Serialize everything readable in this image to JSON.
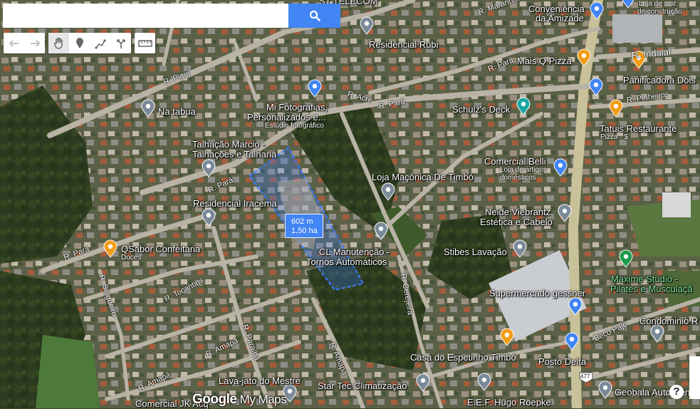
{
  "search": {
    "placeholder": "",
    "value": ""
  },
  "toolbar": {
    "undo": "undo",
    "redo": "redo",
    "pan": "pan",
    "marker": "marker",
    "line": "line",
    "directions": "directions",
    "measure": "measure"
  },
  "measurement": {
    "distance": "602 m",
    "area": "1,50 ha"
  },
  "pois": [
    {
      "label": "Residencial Rubi",
      "sub": ""
    },
    {
      "label": "Conveniência",
      "sub": ""
    },
    {
      "label": "da Amizade",
      "sub": ""
    },
    {
      "label": "Mais Q Pizza",
      "sub": ""
    },
    {
      "label": "Panificadora Dois",
      "sub": ""
    },
    {
      "label": "Na tabua",
      "sub": ""
    },
    {
      "label": "Mi Fotografias,",
      "sub": ""
    },
    {
      "label": "Personalizados e...",
      "sub": "Estúdio fotográfico"
    },
    {
      "label": "Schulz's Deck",
      "sub": ""
    },
    {
      "label": "Tatuis Restaurante",
      "sub": "Pizza · $"
    },
    {
      "label": "Talhação Marcio -",
      "sub": ""
    },
    {
      "label": "Talhações e Talharia",
      "sub": ""
    },
    {
      "label": "Comercial Belli",
      "sub": "Loja de artigos domésticos"
    },
    {
      "label": "Loja Maçônica De Timbó",
      "sub": ""
    },
    {
      "label": "Residencial Iracema",
      "sub": ""
    },
    {
      "label": "Neide Viebrantz",
      "sub": ""
    },
    {
      "label": "Estética e Cabelo",
      "sub": ""
    },
    {
      "label": "QSabor Confeitaria",
      "sub": "Doces"
    },
    {
      "label": "CL Manutenção -",
      "sub": ""
    },
    {
      "label": "Tornos Automáticos",
      "sub": ""
    },
    {
      "label": "Stibes Lavação",
      "sub": ""
    },
    {
      "label": "Maxime Studio -",
      "sub": ""
    },
    {
      "label": "Pilates e Musculaçã",
      "sub": ""
    },
    {
      "label": "Supermercado gessner",
      "sub": ""
    },
    {
      "label": "Condominio R",
      "sub": ""
    },
    {
      "label": "Casa do Espetinho Timbó",
      "sub": ""
    },
    {
      "label": "Posto Delta",
      "sub": ""
    },
    {
      "label": "Lava-jato do Mestre",
      "sub": ""
    },
    {
      "label": "Star Tec Climatização",
      "sub": ""
    },
    {
      "label": "Geobala Auto Cent",
      "sub": ""
    },
    {
      "label": "E.E.F. Hugo Roepke",
      "sub": ""
    },
    {
      "label": "Comercial JK Acq",
      "sub": ""
    },
    {
      "label": "ST TELECOM",
      "sub": ""
    },
    {
      "label": "Loja de mat",
      "sub": "de construção"
    }
  ],
  "streets": [
    "R. Piauí",
    "R. Acre",
    "R. Pará",
    "R. Pará",
    "R. Maranhão",
    "R. Indaial",
    "R. Pinheiros",
    "R. Pará",
    "R. Pará",
    "R. Salgueiro",
    "R. Tocantins",
    "R. Paraíba",
    "R. Amapá",
    "R. Amapá",
    "R. Amapá",
    "R. Cerejeira",
    "Beco Pajé",
    "477"
  ],
  "logo": {
    "brand": "Google",
    "product": " My Maps"
  },
  "help": "?",
  "colors": {
    "search_blue": "#4285f4",
    "polygon": "#3b7bff",
    "pin_gray": "#7b8a99",
    "pin_orange": "#f29d18",
    "pin_blue": "#4285f4",
    "pin_teal": "#19a6a0",
    "pin_green": "#1e9c4b"
  }
}
